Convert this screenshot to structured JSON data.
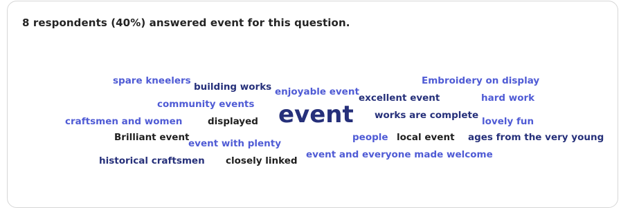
{
  "summary_text": "8 respondents (40%) answered event for this question.",
  "word_cloud": [
    {
      "text": "spare kneelers",
      "tone": "light"
    },
    {
      "text": "building works",
      "tone": "navy"
    },
    {
      "text": "enjoyable event",
      "tone": "light"
    },
    {
      "text": "excellent event",
      "tone": "navy"
    },
    {
      "text": "Embroidery on display",
      "tone": "light"
    },
    {
      "text": "hard work",
      "tone": "light"
    },
    {
      "text": "community events",
      "tone": "light"
    },
    {
      "text": "event",
      "tone": "navy",
      "emphasis": "primary"
    },
    {
      "text": "works are complete",
      "tone": "navy"
    },
    {
      "text": "craftsmen and women",
      "tone": "light"
    },
    {
      "text": "displayed",
      "tone": "dark"
    },
    {
      "text": "lovely fun",
      "tone": "light"
    },
    {
      "text": "Brilliant event",
      "tone": "dark"
    },
    {
      "text": "event with plenty",
      "tone": "light"
    },
    {
      "text": "people",
      "tone": "light"
    },
    {
      "text": "local event",
      "tone": "dark"
    },
    {
      "text": "ages from the very young",
      "tone": "navy"
    },
    {
      "text": "historical craftsmen",
      "tone": "navy"
    },
    {
      "text": "closely linked",
      "tone": "dark"
    },
    {
      "text": "event and everyone made welcome",
      "tone": "light"
    }
  ]
}
